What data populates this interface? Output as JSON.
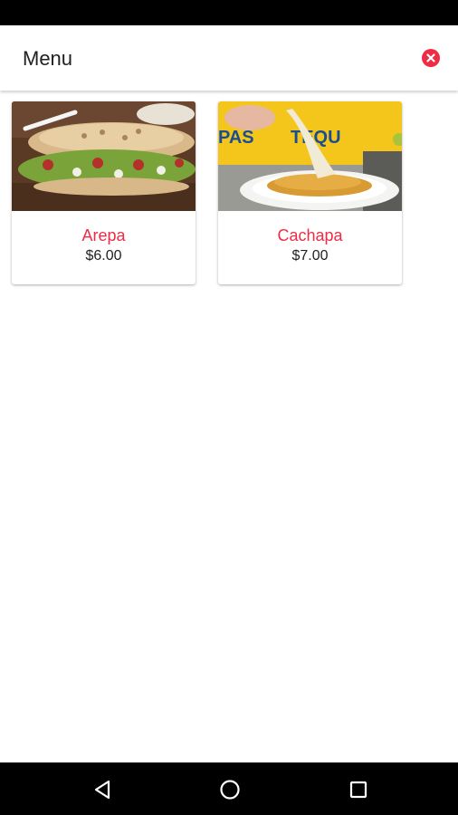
{
  "app_bar": {
    "title": "Menu",
    "close_icon": "close-circle-icon",
    "accent_color": "#ef2c46"
  },
  "menu_items": [
    {
      "name": "Arepa",
      "price": "$6.00",
      "image": "arepa-photo"
    },
    {
      "name": "Cachapa",
      "price": "$7.00",
      "image": "cachapa-photo"
    }
  ],
  "nav_bar": {
    "back_icon": "back-triangle-icon",
    "home_icon": "home-circle-icon",
    "recent_icon": "recents-square-icon"
  }
}
